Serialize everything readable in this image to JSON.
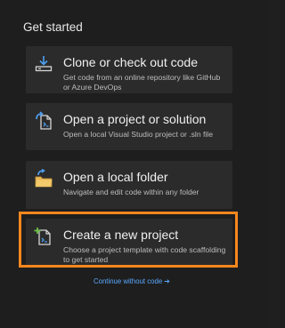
{
  "heading": "Get started",
  "cards": [
    {
      "icon": "clone-download-icon",
      "title": "Clone or check out code",
      "description": "Get code from an online repository like GitHub or Azure DevOps"
    },
    {
      "icon": "open-project-icon",
      "title": "Open a project or solution",
      "description": "Open a local Visual Studio project or .sln file"
    },
    {
      "icon": "open-folder-icon",
      "title": "Open a local folder",
      "description": "Navigate and edit code within any folder"
    },
    {
      "icon": "new-project-icon",
      "title": "Create a new project",
      "description": "Choose a project template with code scaffolding to get started"
    }
  ],
  "continue_link": {
    "label": "Continue without code",
    "arrow": "➔"
  },
  "colors": {
    "background": "#1e1e1e",
    "card": "#2b2b2b",
    "highlight": "#f7871e",
    "link": "#5aa9ff",
    "icon_blue": "#4ea1f3",
    "icon_green": "#6cc24a",
    "icon_folder": "#e8b756"
  }
}
